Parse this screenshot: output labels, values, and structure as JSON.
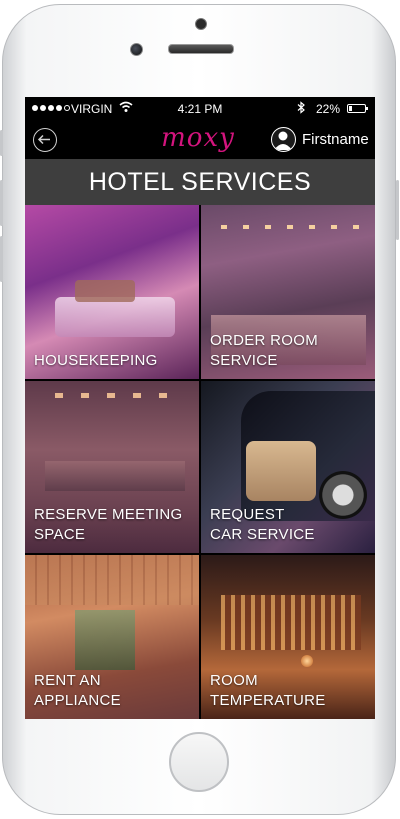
{
  "status_bar": {
    "carrier": "VIRGIN",
    "time": "4:21 PM",
    "battery": "22%",
    "battery_level": 0.22,
    "signal_bars": 4,
    "signal_max": 5
  },
  "header": {
    "logo": "moxy",
    "user_name": "Firstname"
  },
  "page": {
    "title": "HOTEL SERVICES"
  },
  "services": [
    {
      "label": "HOUSEKEEPING"
    },
    {
      "label_line1": "ORDER ROOM",
      "label_line2": "SERVICE"
    },
    {
      "label_line1": "RESERVE MEETING",
      "label_line2": "SPACE"
    },
    {
      "label_line1": "REQUEST",
      "label_line2": "CAR SERVICE"
    },
    {
      "label_line1": "RENT AN",
      "label_line2": "APPLIANCE"
    },
    {
      "label_line1": "ROOM",
      "label_line2": "TEMPERATURE"
    }
  ],
  "colors": {
    "brand": "#d4147e",
    "title_bar": "#3e3e3e"
  }
}
